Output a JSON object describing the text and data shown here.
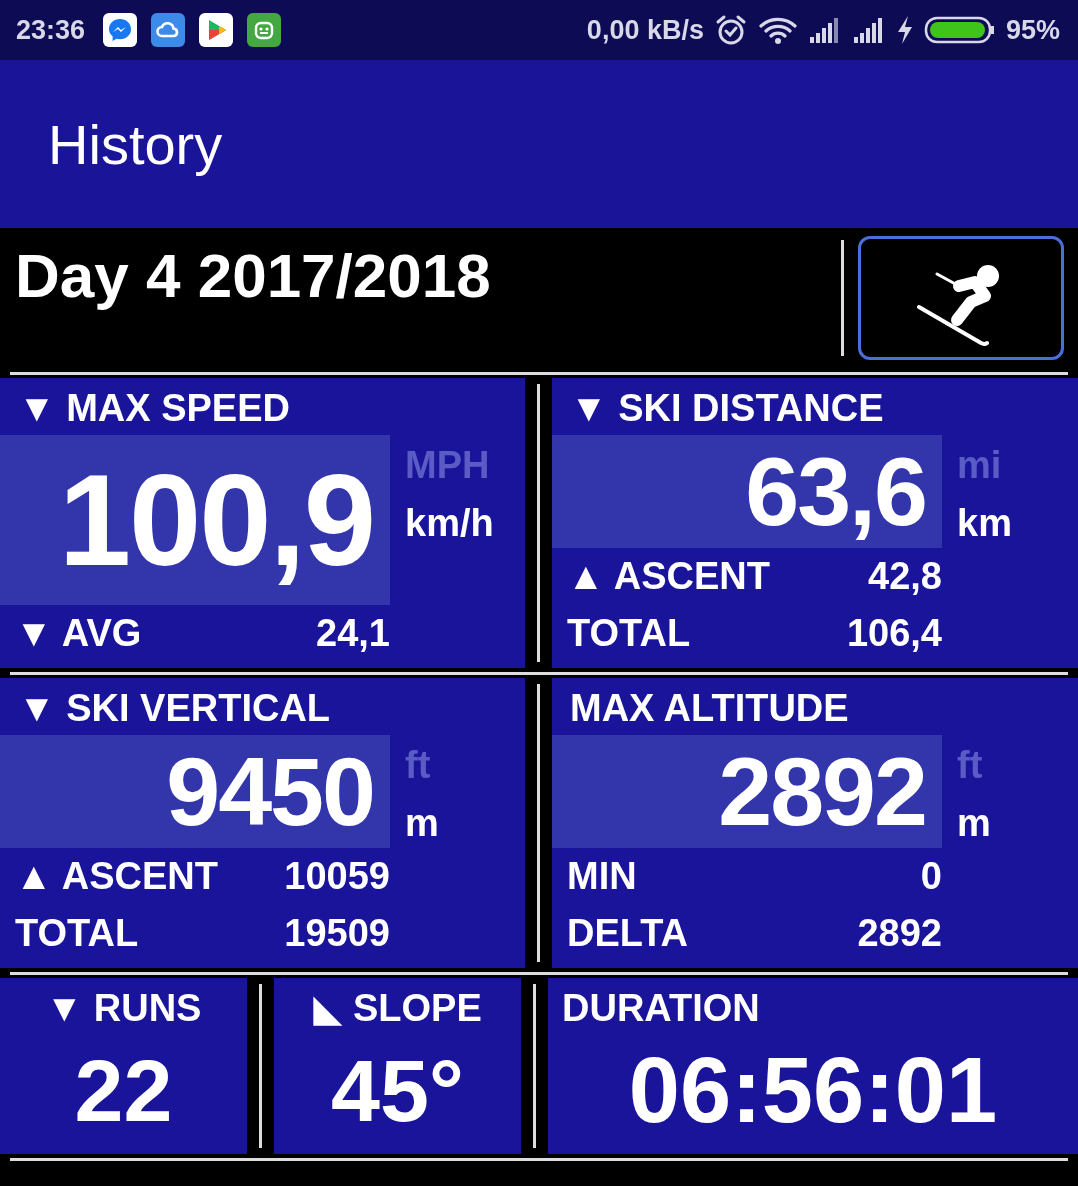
{
  "status_bar": {
    "time": "23:36",
    "net_speed": "0,00 kB/s",
    "battery": "95%"
  },
  "app_bar": {
    "title": "History"
  },
  "header": {
    "title": "Day 4 2017/2018"
  },
  "grid": [
    {
      "tiles": [
        {
          "kind": "metric",
          "label": "▼ MAX SPEED",
          "value": "100,9",
          "units": [
            {
              "label": "MPH",
              "selected": false
            },
            {
              "label": "km/h",
              "selected": true
            }
          ],
          "rows": [
            {
              "label": "▼ AVG",
              "value": "24,1"
            }
          ]
        },
        {
          "kind": "metric",
          "label": "▼ SKI DISTANCE",
          "value": "63,6",
          "units": [
            {
              "label": "mi",
              "selected": false
            },
            {
              "label": "km",
              "selected": true
            }
          ],
          "rows": [
            {
              "label": "▲ ASCENT",
              "value": "42,8"
            },
            {
              "label": "TOTAL",
              "value": "106,4"
            }
          ]
        }
      ]
    },
    {
      "tiles": [
        {
          "kind": "metric",
          "label": "▼ SKI VERTICAL",
          "value": "9450",
          "units": [
            {
              "label": "ft",
              "selected": false
            },
            {
              "label": "m",
              "selected": true
            }
          ],
          "rows": [
            {
              "label": "▲ ASCENT",
              "value": "10059"
            },
            {
              "label": "TOTAL",
              "value": "19509"
            }
          ]
        },
        {
          "kind": "metric",
          "label": "MAX ALTITUDE",
          "value": "2892",
          "units": [
            {
              "label": "ft",
              "selected": false
            },
            {
              "label": "m",
              "selected": true
            }
          ],
          "rows": [
            {
              "label": "MIN",
              "value": "0"
            },
            {
              "label": "DELTA",
              "value": "2892"
            }
          ]
        }
      ]
    },
    {
      "tiles": [
        {
          "kind": "counter",
          "label": "▼ RUNS",
          "value": "22"
        },
        {
          "kind": "counter",
          "label": "◣ SLOPE",
          "value": "45°"
        },
        {
          "kind": "timer",
          "label": "DURATION",
          "value": "06:56:01"
        }
      ]
    }
  ]
}
